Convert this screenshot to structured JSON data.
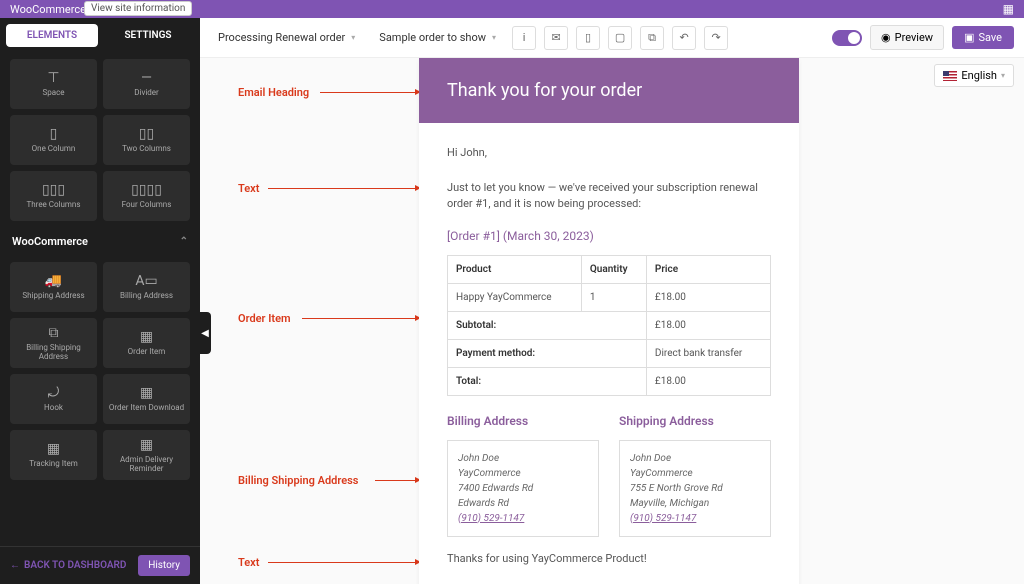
{
  "topbar": {
    "title": "WooCommerce E",
    "info_pill": "View site information"
  },
  "sidebar": {
    "tabs": {
      "elements": "ELEMENTS",
      "settings": "SETTINGS"
    },
    "basic_items": [
      {
        "label": "Space",
        "icon": "⊤"
      },
      {
        "label": "Divider",
        "icon": "—"
      },
      {
        "label": "One Column",
        "icon": "▯"
      },
      {
        "label": "Two Columns",
        "icon": "▯▯"
      },
      {
        "label": "Three Columns",
        "icon": "▯▯▯"
      },
      {
        "label": "Four Columns",
        "icon": "▯▯▯▯"
      }
    ],
    "woo_header": "WooCommerce",
    "woo_items": [
      {
        "label": "Shipping Address",
        "icon": "🚚"
      },
      {
        "label": "Billing Address",
        "icon": "A▭"
      },
      {
        "label": "Billing Shipping Address",
        "icon": "⧉"
      },
      {
        "label": "Order Item",
        "icon": "▦"
      },
      {
        "label": "Hook",
        "icon": "⤾"
      },
      {
        "label": "Order Item Download",
        "icon": "▦"
      },
      {
        "label": "Tracking Item",
        "icon": "▦"
      },
      {
        "label": "Admin Delivery Reminder",
        "icon": "▦"
      }
    ],
    "back": "BACK TO DASHBOARD",
    "history": "History"
  },
  "toolbar": {
    "selector1": "Processing Renewal order",
    "selector2": "Sample order to show",
    "preview": "Preview",
    "save": "Save"
  },
  "language": "English",
  "annotations": {
    "heading": "Email Heading",
    "text1": "Text",
    "order_item": "Order Item",
    "billing_shipping": "Billing Shipping Address",
    "text2": "Text"
  },
  "email": {
    "heading": "Thank you for your order",
    "greeting": "Hi John,",
    "intro": "Just to let you know — we've received your subscription renewal order #1, and it is now being processed:",
    "order_ref": "[Order #1] (March 30, 2023)",
    "table": {
      "headers": [
        "Product",
        "Quantity",
        "Price"
      ],
      "rows": [
        [
          "Happy YayCommerce",
          "1",
          "£18.00"
        ]
      ],
      "summary": [
        [
          "Subtotal:",
          "£18.00"
        ],
        [
          "Payment method:",
          "Direct bank transfer"
        ],
        [
          "Total:",
          "£18.00"
        ]
      ]
    },
    "billing": {
      "title": "Billing Address",
      "name": "John Doe",
      "company": "YayCommerce",
      "line1": "7400 Edwards Rd",
      "line2": "Edwards Rd",
      "phone": "(910) 529-1147"
    },
    "shipping": {
      "title": "Shipping Address",
      "name": "John Doe",
      "company": "YayCommerce",
      "line1": "755 E North Grove Rd",
      "line2": "Mayville, Michigan",
      "phone": "(910) 529-1147"
    },
    "thanks": "Thanks for using YayCommerce Product!"
  }
}
